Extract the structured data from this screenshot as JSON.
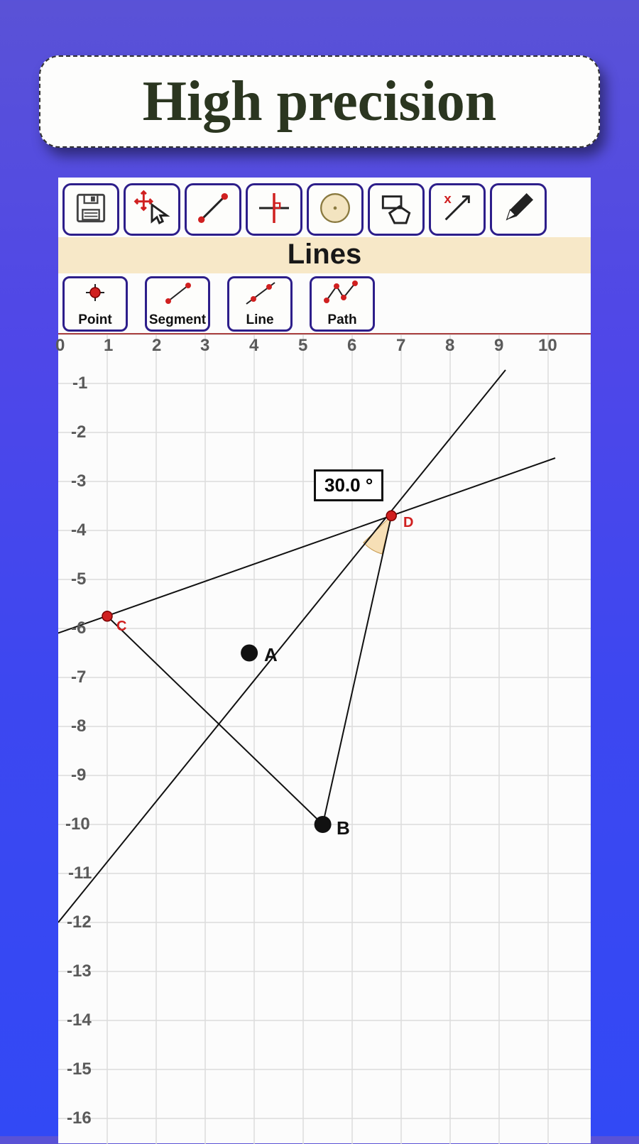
{
  "title": "High precision",
  "section_header": "Lines",
  "subtools": {
    "point": "Point",
    "segment": "Segment",
    "line": "Line",
    "path": "Path"
  },
  "axis": {
    "x": [
      "0",
      "1",
      "2",
      "3",
      "4",
      "5",
      "6",
      "7",
      "8",
      "9",
      "10"
    ],
    "y": [
      "-1",
      "-2",
      "-3",
      "-4",
      "-5",
      "-6",
      "-7",
      "-8",
      "-9",
      "-10",
      "-11",
      "-12",
      "-13",
      "-14",
      "-15",
      "-16"
    ]
  },
  "angle_value": "30.0 °",
  "points": {
    "A": {
      "label": "A",
      "x": 3.9,
      "y": -6.5
    },
    "B": {
      "label": "B",
      "x": 5.4,
      "y": -10.0
    },
    "C": {
      "label": "C",
      "x": 1.0,
      "y": -5.75
    },
    "D": {
      "label": "D",
      "x": 6.8,
      "y": -3.7
    }
  },
  "colors": {
    "accent_border": "#2d1e8a",
    "point_red": "#d02020",
    "grid": "#d8d8d8"
  }
}
